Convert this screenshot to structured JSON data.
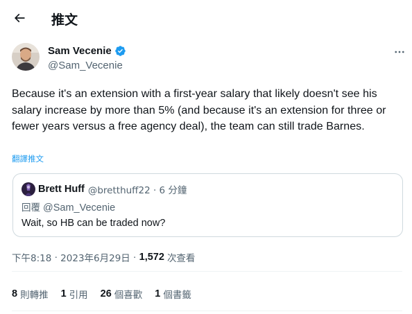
{
  "header": {
    "back_icon": "arrow-left-icon",
    "title": "推文"
  },
  "author": {
    "display_name": "Sam Vecenie",
    "handle": "@Sam_Vecenie",
    "verified_icon": "verified-badge-icon",
    "more_icon": "more-horizontal-icon"
  },
  "tweet": {
    "text": "Because it's an extension with a first-year salary that likely doesn't see his salary increase by more than 5% (and because it's an extension for three or fewer years versus a free agency deal), the team can still trade Barnes.",
    "translate_label": "翻譯推文"
  },
  "quote": {
    "display_name": "Brett Huff",
    "meta": "@bretthuff22 · 6 分鐘",
    "reply_prefix": "回覆",
    "reply_handle": "@Sam_Vecenie",
    "text": "Wait, so HB can be traded now?"
  },
  "meta": {
    "time": "下午8:18",
    "sep1": "·",
    "date": "2023年6月29日",
    "sep2": "·",
    "views_count": "1,572",
    "views_label": "次查看"
  },
  "stats": {
    "retweets_count": "8",
    "retweets_label": "則轉推",
    "quotes_count": "1",
    "quotes_label": "引用",
    "likes_count": "26",
    "likes_label": "個喜歡",
    "bookmarks_count": "1",
    "bookmarks_label": "個書籤"
  },
  "colors": {
    "accent": "#1d9bf0",
    "text_primary": "#0f1419",
    "text_secondary": "#536471",
    "border": "#cfd9de",
    "divider": "#eff3f4"
  }
}
